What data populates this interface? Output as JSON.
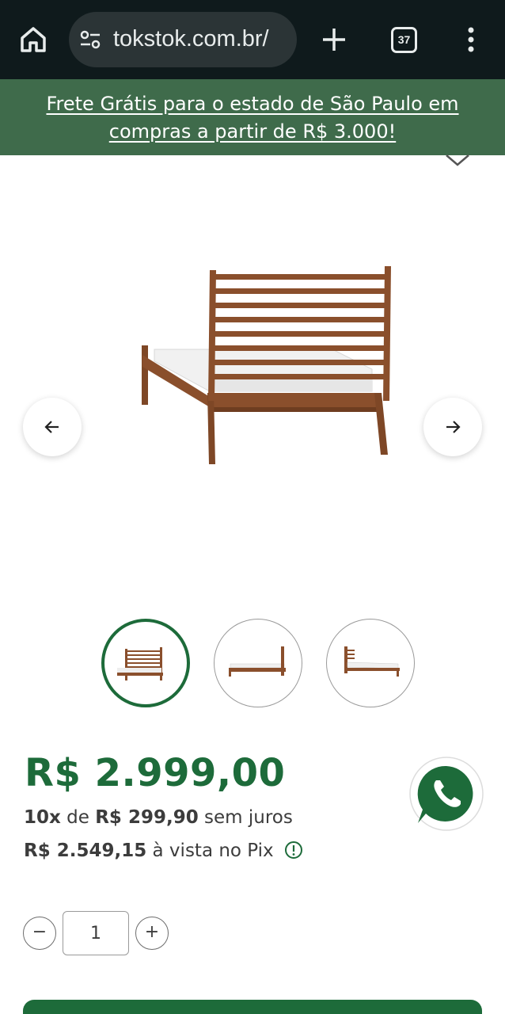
{
  "browser": {
    "url": "tokstok.com.br/",
    "tab_count": "37"
  },
  "promo": {
    "text": "Frete Grátis para o estado de São Paulo em compras a partir de R$ 3.000!"
  },
  "product": {
    "price": "R$ 2.999,00",
    "installments_count": "10x",
    "installments_de": "de",
    "installments_value": "R$ 299,90",
    "installments_suffix": "sem juros",
    "pix_value": "R$ 2.549,15",
    "pix_suffix": "à vista no Pix",
    "quantity": "1",
    "thumbnails_active_index": 0
  },
  "icons": {
    "home": "home-icon",
    "site_settings": "site-settings-icon",
    "new_tab": "plus-icon",
    "menu": "more-vert-icon",
    "prev": "arrow-left-icon",
    "next": "arrow-right-icon",
    "info": "info-icon",
    "whatsapp": "whatsapp-icon"
  },
  "colors": {
    "brand_green": "#1d6b3a",
    "banner_green": "#3f6b4b",
    "browser_bar": "#0f1a1c",
    "wood": "#8a4f2c"
  }
}
